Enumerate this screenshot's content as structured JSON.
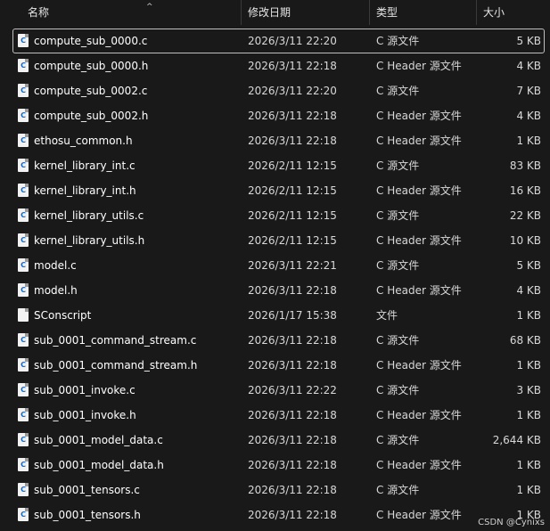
{
  "header": {
    "columns": [
      {
        "label": "名称"
      },
      {
        "label": "修改日期"
      },
      {
        "label": "类型"
      },
      {
        "label": "大小"
      }
    ],
    "sort_indicator": "^"
  },
  "files": [
    {
      "name": "compute_sub_0000.c",
      "date": "2026/3/11 22:20",
      "type": "C 源文件",
      "size": "5 KB",
      "icon": "c-source-file-icon",
      "selected": true
    },
    {
      "name": "compute_sub_0000.h",
      "date": "2026/3/11 22:18",
      "type": "C Header 源文件",
      "size": "4 KB",
      "icon": "c-header-file-icon"
    },
    {
      "name": "compute_sub_0002.c",
      "date": "2026/3/11 22:20",
      "type": "C 源文件",
      "size": "7 KB",
      "icon": "c-source-file-icon"
    },
    {
      "name": "compute_sub_0002.h",
      "date": "2026/3/11 22:18",
      "type": "C Header 源文件",
      "size": "4 KB",
      "icon": "c-header-file-icon"
    },
    {
      "name": "ethosu_common.h",
      "date": "2026/3/11 22:18",
      "type": "C Header 源文件",
      "size": "1 KB",
      "icon": "c-header-file-icon"
    },
    {
      "name": "kernel_library_int.c",
      "date": "2026/2/11 12:15",
      "type": "C 源文件",
      "size": "83 KB",
      "icon": "c-source-file-icon"
    },
    {
      "name": "kernel_library_int.h",
      "date": "2026/2/11 12:15",
      "type": "C Header 源文件",
      "size": "16 KB",
      "icon": "c-header-file-icon"
    },
    {
      "name": "kernel_library_utils.c",
      "date": "2026/2/11 12:15",
      "type": "C 源文件",
      "size": "22 KB",
      "icon": "c-source-file-icon"
    },
    {
      "name": "kernel_library_utils.h",
      "date": "2026/2/11 12:15",
      "type": "C Header 源文件",
      "size": "10 KB",
      "icon": "c-header-file-icon"
    },
    {
      "name": "model.c",
      "date": "2026/3/11 22:21",
      "type": "C 源文件",
      "size": "5 KB",
      "icon": "c-source-file-icon"
    },
    {
      "name": "model.h",
      "date": "2026/3/11 22:18",
      "type": "C Header 源文件",
      "size": "4 KB",
      "icon": "c-header-file-icon"
    },
    {
      "name": "SConscript",
      "date": "2026/1/17 15:38",
      "type": "文件",
      "size": "1 KB",
      "icon": "blank-file-icon"
    },
    {
      "name": "sub_0001_command_stream.c",
      "date": "2026/3/11 22:18",
      "type": "C 源文件",
      "size": "68 KB",
      "icon": "c-source-file-icon"
    },
    {
      "name": "sub_0001_command_stream.h",
      "date": "2026/3/11 22:18",
      "type": "C Header 源文件",
      "size": "1 KB",
      "icon": "c-header-file-icon"
    },
    {
      "name": "sub_0001_invoke.c",
      "date": "2026/3/11 22:22",
      "type": "C 源文件",
      "size": "3 KB",
      "icon": "c-source-file-icon"
    },
    {
      "name": "sub_0001_invoke.h",
      "date": "2026/3/11 22:18",
      "type": "C Header 源文件",
      "size": "1 KB",
      "icon": "c-header-file-icon"
    },
    {
      "name": "sub_0001_model_data.c",
      "date": "2026/3/11 22:18",
      "type": "C 源文件",
      "size": "2,644 KB",
      "icon": "c-source-file-icon"
    },
    {
      "name": "sub_0001_model_data.h",
      "date": "2026/3/11 22:18",
      "type": "C Header 源文件",
      "size": "1 KB",
      "icon": "c-header-file-icon"
    },
    {
      "name": "sub_0001_tensors.c",
      "date": "2026/3/11 22:18",
      "type": "C 源文件",
      "size": "1 KB",
      "icon": "c-source-file-icon"
    },
    {
      "name": "sub_0001_tensors.h",
      "date": "2026/3/11 22:18",
      "type": "C Header 源文件",
      "size": "1 KB",
      "icon": "c-header-file-icon"
    }
  ],
  "watermark": "CSDN @Cynixs",
  "colors": {
    "background": "#191919",
    "selection_border": "#bfbfbf",
    "icon_glyph": "#1565c0"
  }
}
